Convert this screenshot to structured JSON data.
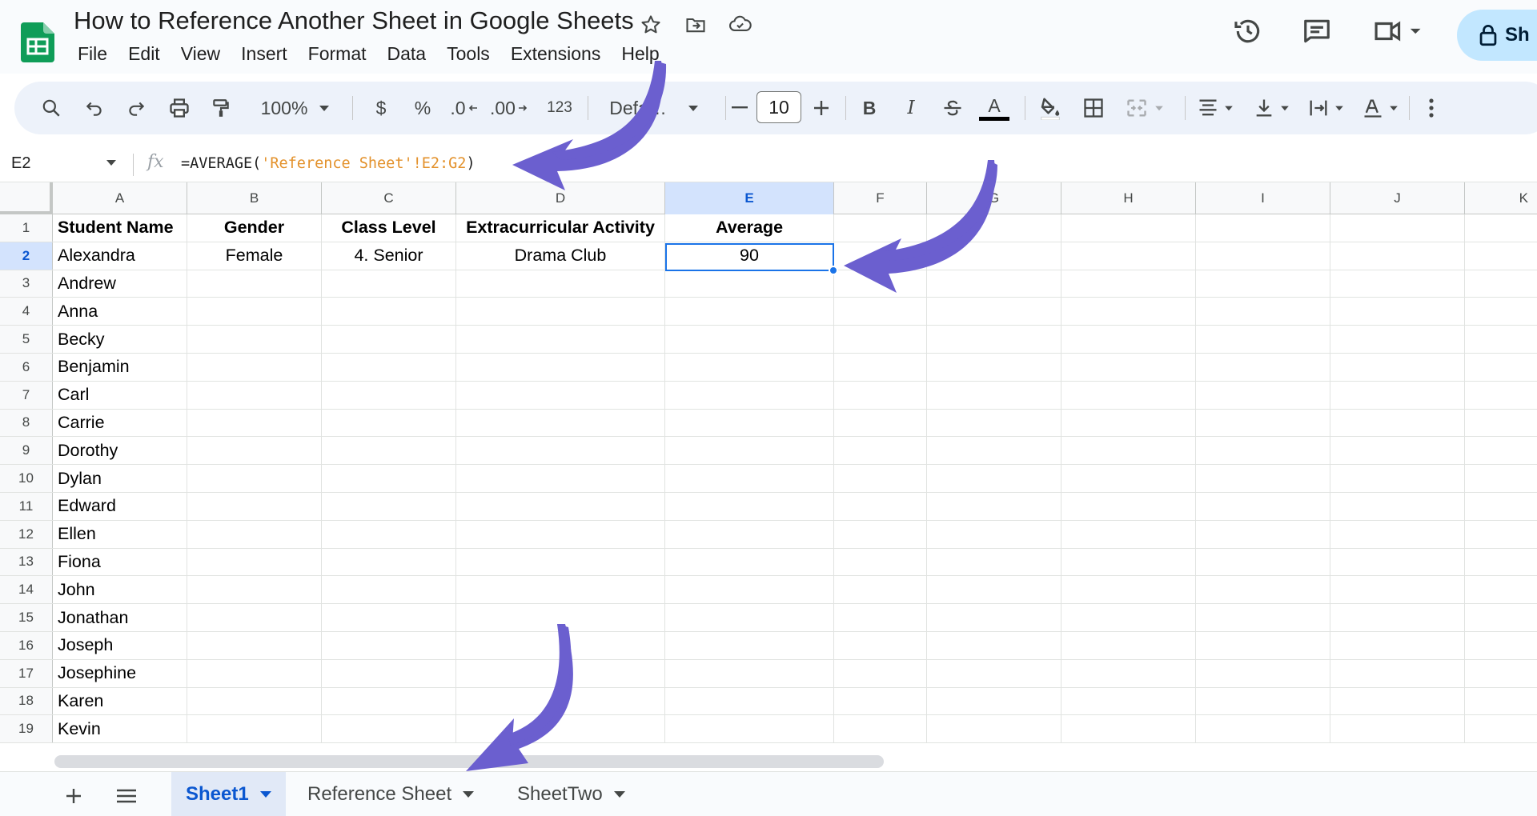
{
  "doc": {
    "title": "How to Reference Another Sheet in Google Sheets"
  },
  "menu": [
    "File",
    "Edit",
    "View",
    "Insert",
    "Format",
    "Data",
    "Tools",
    "Extensions",
    "Help"
  ],
  "share": {
    "label": "Sh"
  },
  "toolbar": {
    "zoom": "100%",
    "currency": "$",
    "percent": "%",
    "dec_decrease": ".0",
    "dec_increase": ".00",
    "number_format": "123",
    "font": "Defa…",
    "font_size": "10",
    "bold": "B",
    "italic": "I",
    "text_color_letter": "A"
  },
  "formula_bar": {
    "cell_ref": "E2",
    "fx": "fx",
    "formula_prefix": "=AVERAGE(",
    "formula_ref": "'Reference Sheet'!E2:G2",
    "formula_suffix": ")"
  },
  "grid": {
    "columns": [
      "A",
      "B",
      "C",
      "D",
      "E",
      "F",
      "G",
      "H",
      "I",
      "J",
      "K"
    ],
    "selected_column": "E",
    "selected_row": "2",
    "header_row": [
      "Student Name",
      "Gender",
      "Class Level",
      "Extracurricular Activity",
      "Average"
    ],
    "row2": [
      "Alexandra",
      "Female",
      "4. Senior",
      "Drama Club",
      "90"
    ],
    "students": [
      "Andrew",
      "Anna",
      "Becky",
      "Benjamin",
      "Carl",
      "Carrie",
      "Dorothy",
      "Dylan",
      "Edward",
      "Ellen",
      "Fiona",
      "John",
      "Jonathan",
      "Joseph",
      "Josephine",
      "Karen",
      "Kevin"
    ],
    "row_numbers": [
      "1",
      "2",
      "3",
      "4",
      "5",
      "6",
      "7",
      "8",
      "9",
      "10",
      "11",
      "12",
      "13",
      "14",
      "15",
      "16",
      "17",
      "18",
      "19"
    ]
  },
  "sheets": {
    "tabs": [
      "Sheet1",
      "Reference Sheet",
      "SheetTwo"
    ],
    "active": "Sheet1"
  },
  "colors": {
    "accent": "#0b57d0",
    "arrow": "#6b5fcf",
    "share_bg": "#c2e7ff",
    "logo": "#0f9d58"
  }
}
